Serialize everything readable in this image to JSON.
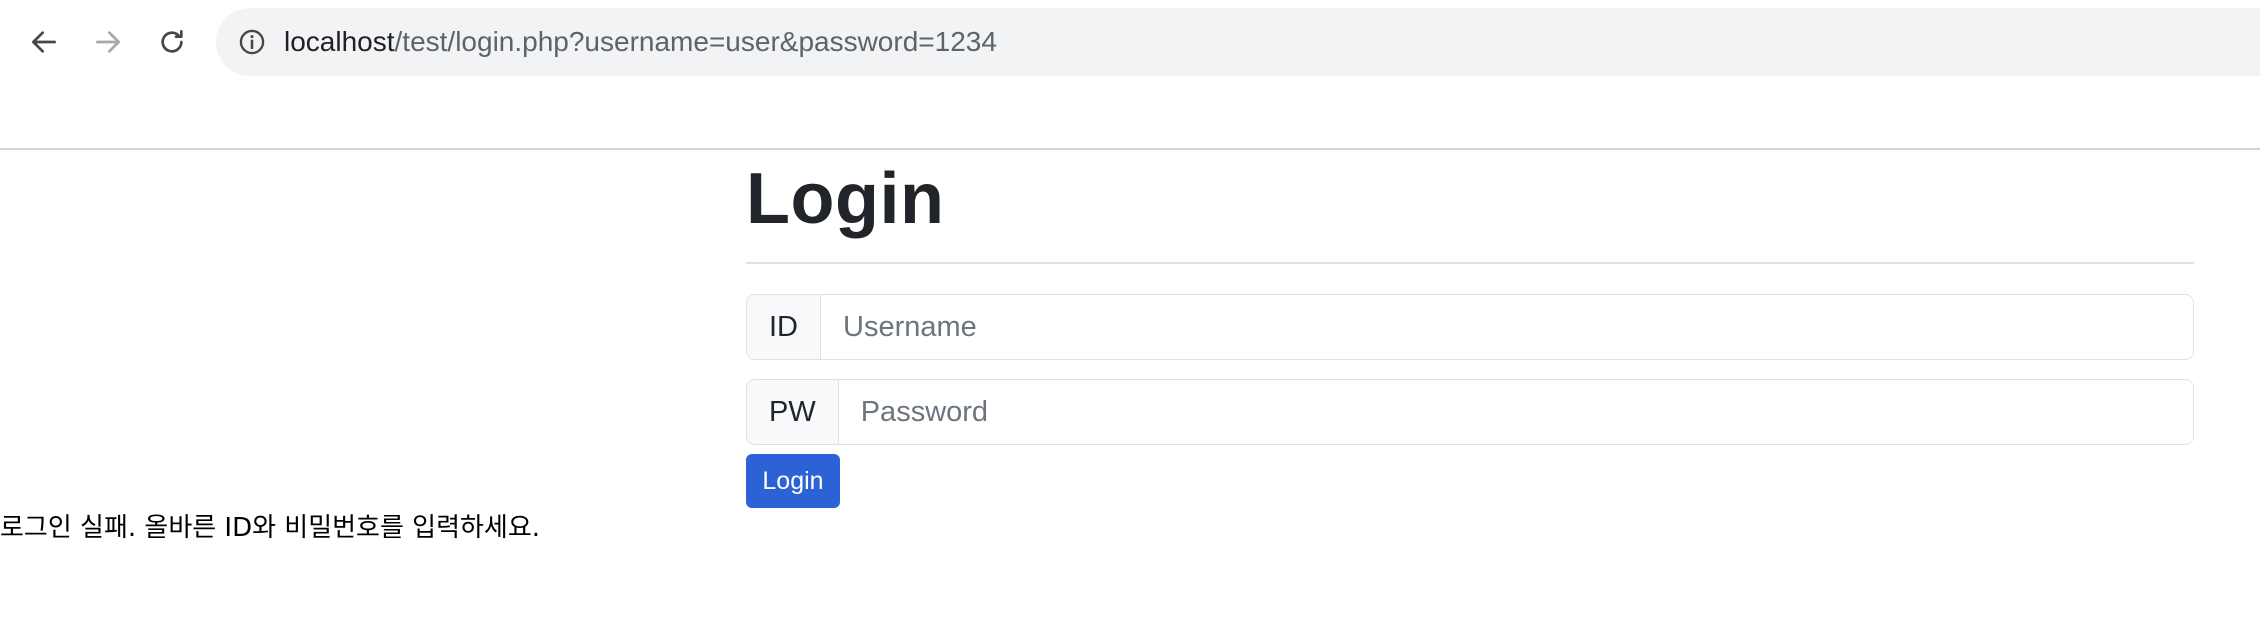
{
  "browser": {
    "url_host": "localhost",
    "url_path": "/test/login.php?username=user&password=1234"
  },
  "page": {
    "title": "Login",
    "id_label": "ID",
    "id_placeholder": "Username",
    "pw_label": "PW",
    "pw_placeholder": "Password",
    "login_button": "Login",
    "error_message": "로그인 실패. 올바른 ID와 비밀번호를 입력하세요."
  },
  "colors": {
    "primary_button": "#2c62d6",
    "omnibox_bg": "#f1f3f4"
  },
  "icons": {
    "back": "arrow-left-icon",
    "forward": "arrow-right-icon",
    "reload": "reload-icon",
    "site_info": "info-circle-icon"
  }
}
